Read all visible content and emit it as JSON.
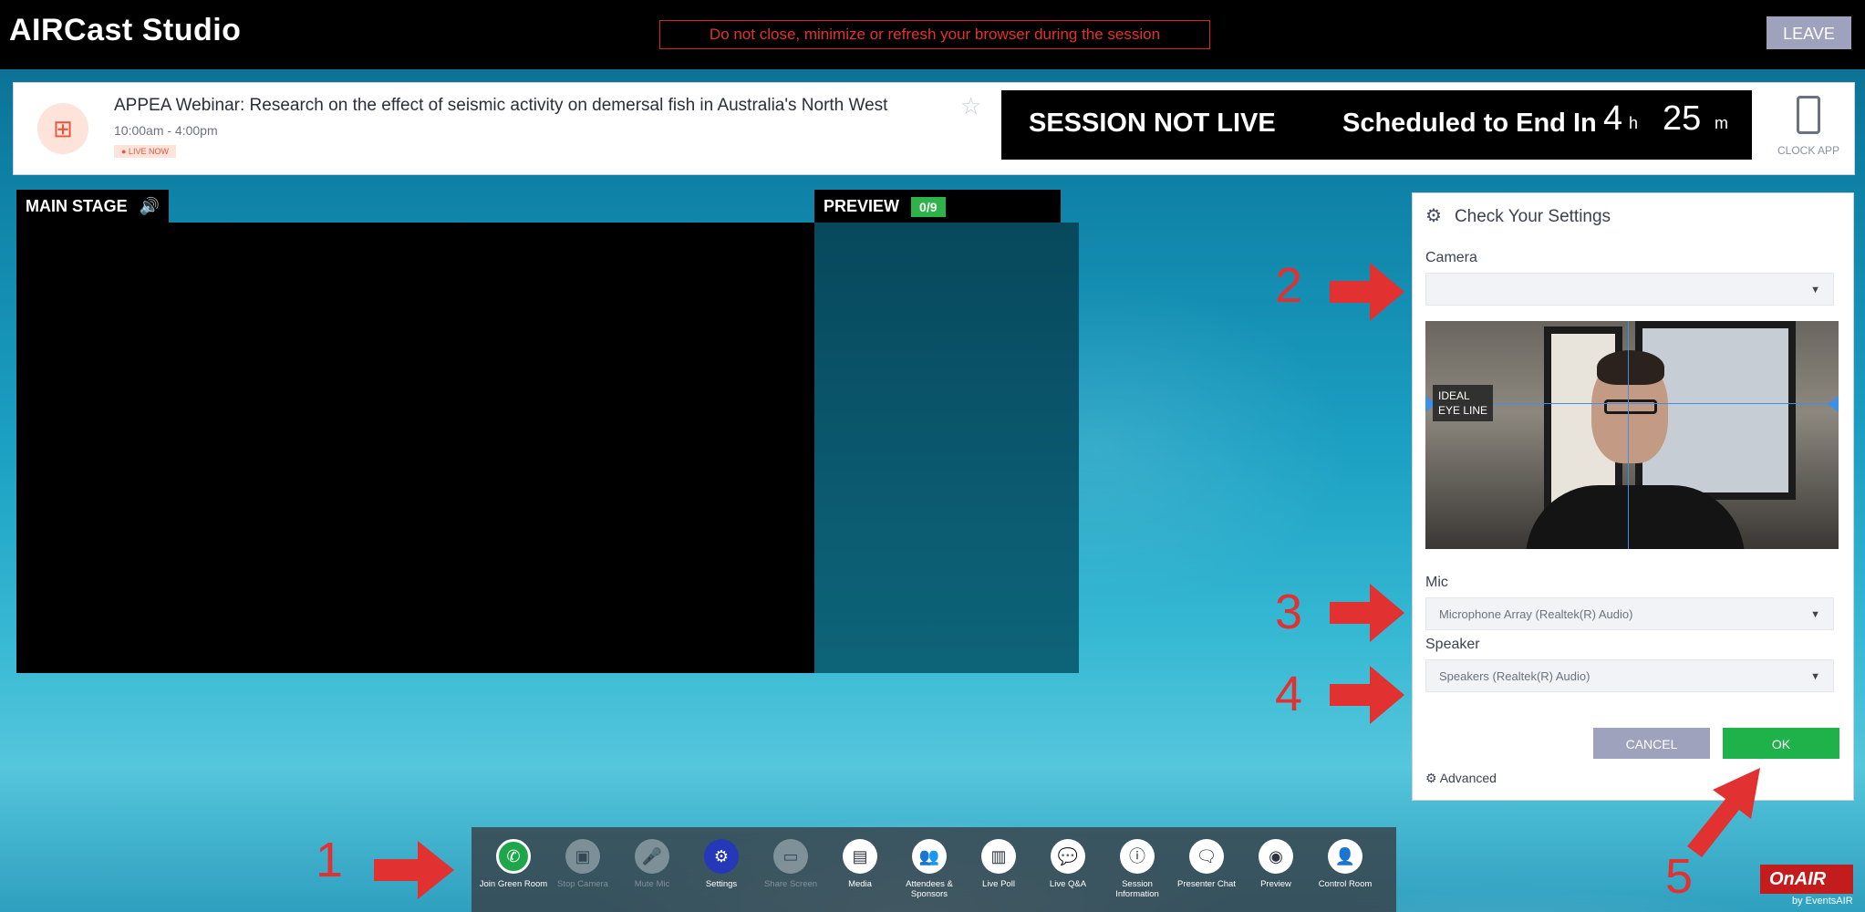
{
  "app": {
    "title": "AIRCast Studio",
    "warning": "Do not close, minimize or refresh your browser during the session",
    "leave_label": "LEAVE"
  },
  "session": {
    "title": "APPEA Webinar: Research on the effect of seismic activity on demersal fish in Australia's North West",
    "time": "10:00am - 4:00pm",
    "live_badge": "● LIVE NOW",
    "status": "SESSION NOT LIVE",
    "scheduled_label": "Scheduled to End In",
    "hours": "4",
    "hours_unit": "h",
    "minutes": "25",
    "minutes_unit": "m",
    "clock_app_label": "CLOCK APP"
  },
  "stage": {
    "main_label": "MAIN STAGE",
    "preview_label": "PREVIEW",
    "preview_count": "0/9"
  },
  "settings": {
    "title": "Check Your Settings",
    "camera_label": "Camera",
    "camera_value": "",
    "eyeline_label": "IDEAL\nEYE LINE",
    "mic_label": "Mic",
    "mic_value": "Microphone Array (Realtek(R) Audio)",
    "speaker_label": "Speaker",
    "speaker_value": "Speakers (Realtek(R) Audio)",
    "cancel_label": "CANCEL",
    "ok_label": "OK",
    "advanced_label": "Advanced"
  },
  "toolbar": [
    {
      "label": "Join Green Room",
      "icon": "phone-icon",
      "state": "green"
    },
    {
      "label": "Stop Camera",
      "icon": "camera-icon",
      "state": "disabled"
    },
    {
      "label": "Mute Mic",
      "icon": "mic-icon",
      "state": "disabled"
    },
    {
      "label": "Settings",
      "icon": "gear-icon",
      "state": "active"
    },
    {
      "label": "Share Screen",
      "icon": "screen-icon",
      "state": "disabled"
    },
    {
      "label": "Media",
      "icon": "media-icon",
      "state": "normal"
    },
    {
      "label": "Attendees & Sponsors",
      "icon": "people-icon",
      "state": "normal"
    },
    {
      "label": "Live Poll",
      "icon": "poll-icon",
      "state": "normal"
    },
    {
      "label": "Live Q&A",
      "icon": "qa-icon",
      "state": "normal"
    },
    {
      "label": "Session Information",
      "icon": "info-icon",
      "state": "normal"
    },
    {
      "label": "Presenter Chat",
      "icon": "chat-icon",
      "state": "normal"
    },
    {
      "label": "Preview",
      "icon": "eye-icon",
      "state": "normal"
    },
    {
      "label": "Control Room",
      "icon": "user-icon",
      "state": "normal"
    }
  ],
  "annotations": [
    "1",
    "2",
    "3",
    "4",
    "5"
  ],
  "branding": {
    "onair": "OnAIR",
    "events_air": "by EventsAIR"
  },
  "colors": {
    "accent_red": "#e23131",
    "ok_green": "#1fb24a",
    "leave_gray": "#9ea2bd",
    "warning_red": "#d9261c"
  }
}
